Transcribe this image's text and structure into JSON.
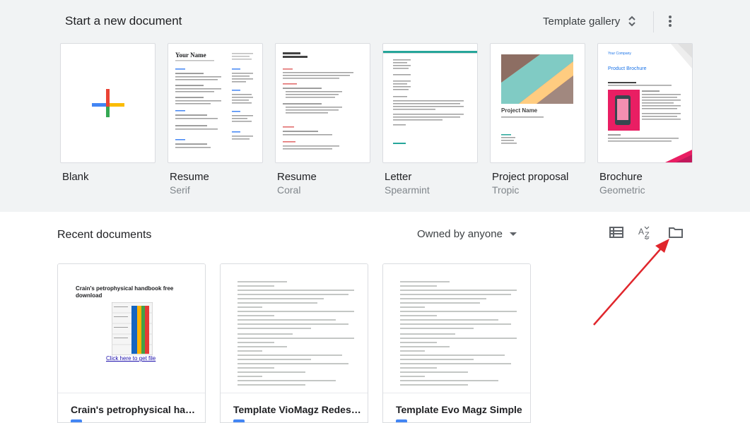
{
  "header": {
    "title": "Start a new document",
    "gallery_label": "Template gallery"
  },
  "templates": [
    {
      "name": "Blank",
      "sub": ""
    },
    {
      "name": "Resume",
      "sub": "Serif",
      "thumb_heading": "Your Name"
    },
    {
      "name": "Resume",
      "sub": "Coral"
    },
    {
      "name": "Letter",
      "sub": "Spearmint"
    },
    {
      "name": "Project proposal",
      "sub": "Tropic",
      "thumb_heading": "Project Name"
    },
    {
      "name": "Brochure",
      "sub": "Geometric",
      "thumb_company": "Your Company",
      "thumb_heading": "Product Brochure"
    }
  ],
  "recent": {
    "title": "Recent documents",
    "owner_filter": "Owned by anyone",
    "docs": [
      {
        "title": "Crain's petrophysical handbook free download",
        "preview_heading": "Crain's petrophysical handbook free download",
        "preview_link": "Click here to get file"
      },
      {
        "title": "Template VioMagz Redesign"
      },
      {
        "title": "Template Evo Magz Simple"
      }
    ]
  },
  "colors": {
    "accent": "#4285f4",
    "annotation_arrow": "#e0262c"
  },
  "icons": [
    "plus-icon",
    "unfold-icon",
    "more-vert-icon",
    "list-view-icon",
    "sort-az-icon",
    "folder-icon"
  ]
}
